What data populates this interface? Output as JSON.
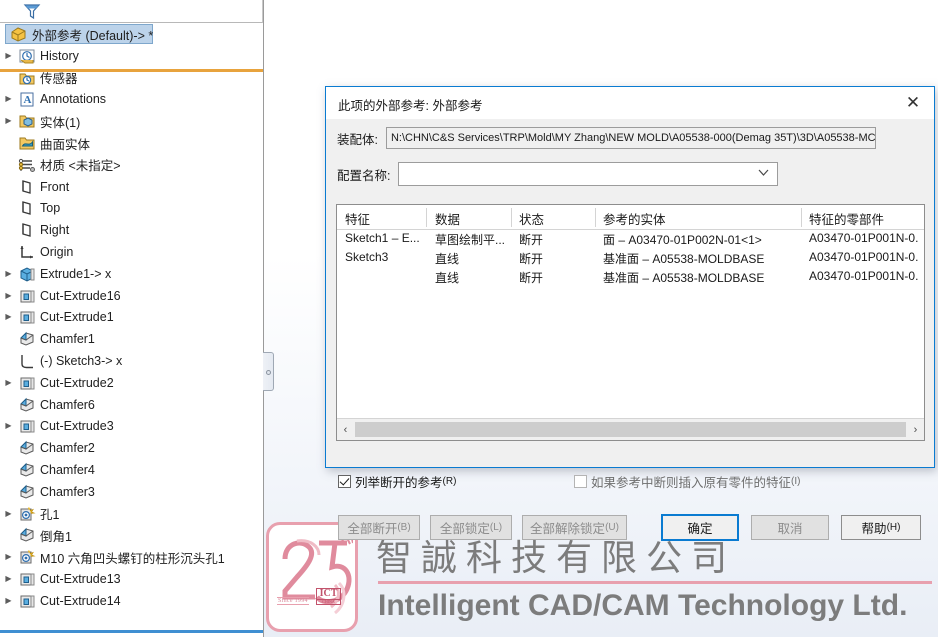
{
  "tree": {
    "toolbar": {
      "filter_icon": "funnel-icon"
    },
    "root": {
      "label": "外部参考  (Default)-> *",
      "icon": "part-icon",
      "selected": true
    },
    "items": [
      {
        "label": "History",
        "icon": "history-icon",
        "arrow": true,
        "indent": 1
      },
      {
        "label": "传感器",
        "icon": "sensor-icon",
        "arrow": false,
        "indent": 1
      },
      {
        "label": "Annotations",
        "icon": "annotations-icon",
        "arrow": true,
        "indent": 1
      },
      {
        "label": "实体(1)",
        "icon": "solidbody-icon",
        "arrow": true,
        "indent": 1
      },
      {
        "label": "曲面实体",
        "icon": "surfacebody-icon",
        "arrow": false,
        "indent": 1
      },
      {
        "label": "材质 <未指定>",
        "icon": "material-icon",
        "arrow": false,
        "indent": 1
      },
      {
        "label": "Front",
        "icon": "plane-icon",
        "arrow": false,
        "indent": 1
      },
      {
        "label": "Top",
        "icon": "plane-icon",
        "arrow": false,
        "indent": 1
      },
      {
        "label": "Right",
        "icon": "plane-icon",
        "arrow": false,
        "indent": 1
      },
      {
        "label": "Origin",
        "icon": "origin-icon",
        "arrow": false,
        "indent": 1
      },
      {
        "label": "Extrude1-> x",
        "icon": "extrude-icon",
        "arrow": true,
        "indent": 1
      },
      {
        "label": "Cut-Extrude16",
        "icon": "cut-extrude-icon",
        "arrow": true,
        "indent": 1
      },
      {
        "label": "Cut-Extrude1",
        "icon": "cut-extrude-icon",
        "arrow": true,
        "indent": 1
      },
      {
        "label": "Chamfer1",
        "icon": "chamfer-icon",
        "arrow": false,
        "indent": 1
      },
      {
        "label": "(-) Sketch3-> x",
        "icon": "sketch-icon",
        "arrow": false,
        "indent": 1
      },
      {
        "label": "Cut-Extrude2",
        "icon": "cut-extrude-icon",
        "arrow": true,
        "indent": 1
      },
      {
        "label": "Chamfer6",
        "icon": "chamfer-icon",
        "arrow": false,
        "indent": 1
      },
      {
        "label": "Cut-Extrude3",
        "icon": "cut-extrude-icon",
        "arrow": true,
        "indent": 1
      },
      {
        "label": "Chamfer2",
        "icon": "chamfer-icon",
        "arrow": false,
        "indent": 1
      },
      {
        "label": "Chamfer4",
        "icon": "chamfer-icon",
        "arrow": false,
        "indent": 1
      },
      {
        "label": "Chamfer3",
        "icon": "chamfer-icon",
        "arrow": false,
        "indent": 1
      },
      {
        "label": "孔1",
        "icon": "hole-wizard-icon",
        "arrow": true,
        "indent": 1
      },
      {
        "label": "倒角1",
        "icon": "chamfer-icon",
        "arrow": false,
        "indent": 1
      },
      {
        "label": "M10 六角凹头螺钉的柱形沉头孔1",
        "icon": "hole-wizard-icon",
        "arrow": true,
        "indent": 1
      },
      {
        "label": "Cut-Extrude13",
        "icon": "cut-extrude-icon",
        "arrow": true,
        "indent": 1
      },
      {
        "label": "Cut-Extrude14",
        "icon": "cut-extrude-icon",
        "arrow": true,
        "indent": 1
      }
    ]
  },
  "dialog": {
    "title": "此项的外部参考: 外部参考",
    "close_label": "✕",
    "assembly": {
      "label": "装配体:",
      "value": "N:\\CHN\\C&S Services\\TRP\\Mold\\MY Zhang\\NEW MOLD\\A05538-000(Demag 35T)\\3D\\A05538-MC"
    },
    "configuration": {
      "label": "配置名称:",
      "value": "",
      "placeholder": ""
    },
    "table": {
      "headers": [
        "特征",
        "数据",
        "状态",
        "参考的实体",
        "特征的零部件"
      ],
      "rows": [
        {
          "feature": "Sketch1 – E...",
          "data": "草图绘制平...",
          "status": "断开",
          "referenced_entity": "面 – A03470-01P002N-01<1>",
          "feature_component": "A03470-01P001N-0..."
        },
        {
          "feature": "Sketch3",
          "data": "直线",
          "status": "断开",
          "referenced_entity": "基准面 – A05538-MOLDBASE",
          "feature_component": "A03470-01P001N-0..."
        },
        {
          "feature": "",
          "data": "直线",
          "status": "断开",
          "referenced_entity": "基准面 – A05538-MOLDBASE",
          "feature_component": "A03470-01P001N-0..."
        }
      ],
      "scroll_left_icon": "‹",
      "scroll_right_icon": "›"
    },
    "checkboxes": [
      {
        "label": "列举断开的参考",
        "hint": "(R)",
        "checked": true
      },
      {
        "label": "如果参考中断则插入原有零件的特征",
        "hint": "(I)",
        "checked": false
      }
    ],
    "buttons": {
      "break_all": {
        "label": "全部断开",
        "hint": "(B)",
        "enabled": false
      },
      "lock_all": {
        "label": "全部锁定",
        "hint": "(L)",
        "enabled": false
      },
      "unlock_all": {
        "label": "全部解除锁定",
        "hint": "(U)",
        "enabled": false
      },
      "ok": {
        "label": "确定",
        "hint": "",
        "enabled": true
      },
      "cancel": {
        "label": "取消",
        "hint": "",
        "enabled": false
      },
      "help": {
        "label": "帮助",
        "hint": "(H)",
        "enabled": true
      }
    }
  },
  "watermark": {
    "badge_number": "25",
    "badge_since": "Since 1994",
    "badge_mark_big": "ICT",
    "badge_mark_small": "CHINA",
    "company_cn": "智誠科技有限公司",
    "company_en": "Intelligent CAD/CAM Technology Ltd."
  },
  "colors": {
    "accent_blue": "#0a7bd1",
    "selection_blue": "#bcd3ea",
    "root_underline": "#e8a33d",
    "tree_bottom": "#3f8fd2",
    "logo_pink": "#e8a0ae",
    "logo_rose": "#c2536c",
    "watermark_grey": "#7c7c7c"
  }
}
